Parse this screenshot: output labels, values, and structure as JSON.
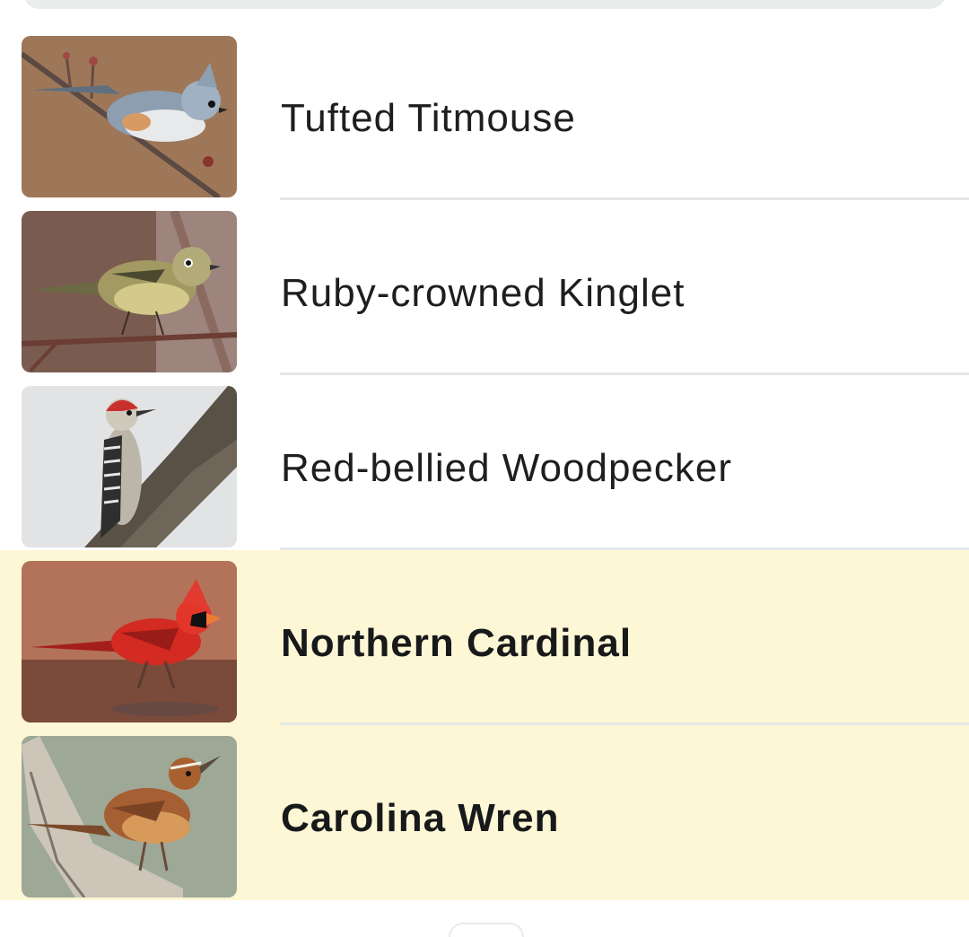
{
  "birds": [
    {
      "name": "Tufted Titmouse",
      "highlighted": false,
      "icon": "tufted-titmouse-photo"
    },
    {
      "name": "Ruby-crowned Kinglet",
      "highlighted": false,
      "icon": "ruby-crowned-kinglet-photo"
    },
    {
      "name": "Red-bellied Woodpecker",
      "highlighted": false,
      "icon": "red-bellied-woodpecker-photo"
    },
    {
      "name": "Northern Cardinal",
      "highlighted": true,
      "icon": "northern-cardinal-photo"
    },
    {
      "name": "Carolina Wren",
      "highlighted": true,
      "icon": "carolina-wren-photo"
    }
  ],
  "colors": {
    "highlight_background": "#fef7d6",
    "divider": "#e3e8e7",
    "text": "#1d1f1e"
  }
}
